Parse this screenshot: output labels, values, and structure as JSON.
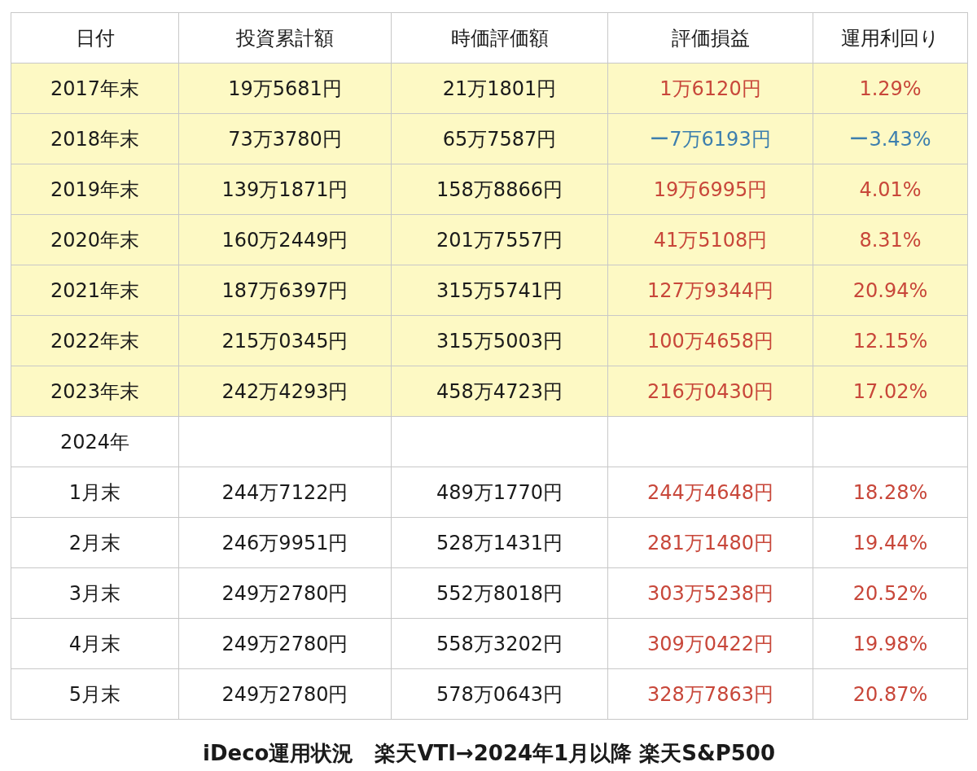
{
  "table": {
    "columns": [
      "日付",
      "投資累計額",
      "時価評価額",
      "評価損益",
      "運用利回り"
    ],
    "rows": [
      {
        "cells": [
          "2017年末",
          "19万5681円",
          "21万1801円",
          "1万6120円",
          "1.29%"
        ],
        "highlighted": true,
        "color": "#c8473a"
      },
      {
        "cells": [
          "2018年末",
          "73万3780円",
          "65万7587円",
          "ー7万6193円",
          "ー3.43%"
        ],
        "highlighted": true,
        "color": "#3d7fae"
      },
      {
        "cells": [
          "2019年末",
          "139万1871円",
          "158万8866円",
          "19万6995円",
          "4.01%"
        ],
        "highlighted": true,
        "color": "#c8473a"
      },
      {
        "cells": [
          "2020年末",
          "160万2449円",
          "201万7557円",
          "41万5108円",
          "8.31%"
        ],
        "highlighted": true,
        "color": "#c8473a"
      },
      {
        "cells": [
          "2021年末",
          "187万6397円",
          "315万5741円",
          "127万9344円",
          "20.94%"
        ],
        "highlighted": true,
        "color": "#c8473a"
      },
      {
        "cells": [
          "2022年末",
          "215万0345円",
          "315万5003円",
          "100万4658円",
          "12.15%"
        ],
        "highlighted": true,
        "color": "#c8473a"
      },
      {
        "cells": [
          "2023年末",
          "242万4293円",
          "458万4723円",
          "216万0430円",
          "17.02%"
        ],
        "highlighted": true,
        "color": "#c8473a"
      },
      {
        "cells": [
          "2024年"
        ],
        "highlighted": false
      },
      {
        "cells": [
          "1月末",
          "244万7122円",
          "489万1770円",
          "244万4648円",
          "18.28%"
        ],
        "highlighted": false,
        "color": "#c8473a"
      },
      {
        "cells": [
          "2月末",
          "246万9951円",
          "528万1431円",
          "281万1480円",
          "19.44%"
        ],
        "highlighted": false,
        "color": "#c8473a"
      },
      {
        "cells": [
          "3月末",
          "249万2780円",
          "552万8018円",
          "303万5238円",
          "20.52%"
        ],
        "highlighted": false,
        "color": "#c8473a"
      },
      {
        "cells": [
          "4月末",
          "249万2780円",
          "558万3202円",
          "309万0422円",
          "19.98%"
        ],
        "highlighted": false,
        "color": "#c8473a"
      },
      {
        "cells": [
          "5月末",
          "249万2780円",
          "578万0643円",
          "328万7863円",
          "20.87%"
        ],
        "highlighted": false,
        "color": "#c8473a"
      }
    ]
  },
  "caption": "iDeco運用状況　楽天VTI→2024年1月以降 楽天S&P500"
}
